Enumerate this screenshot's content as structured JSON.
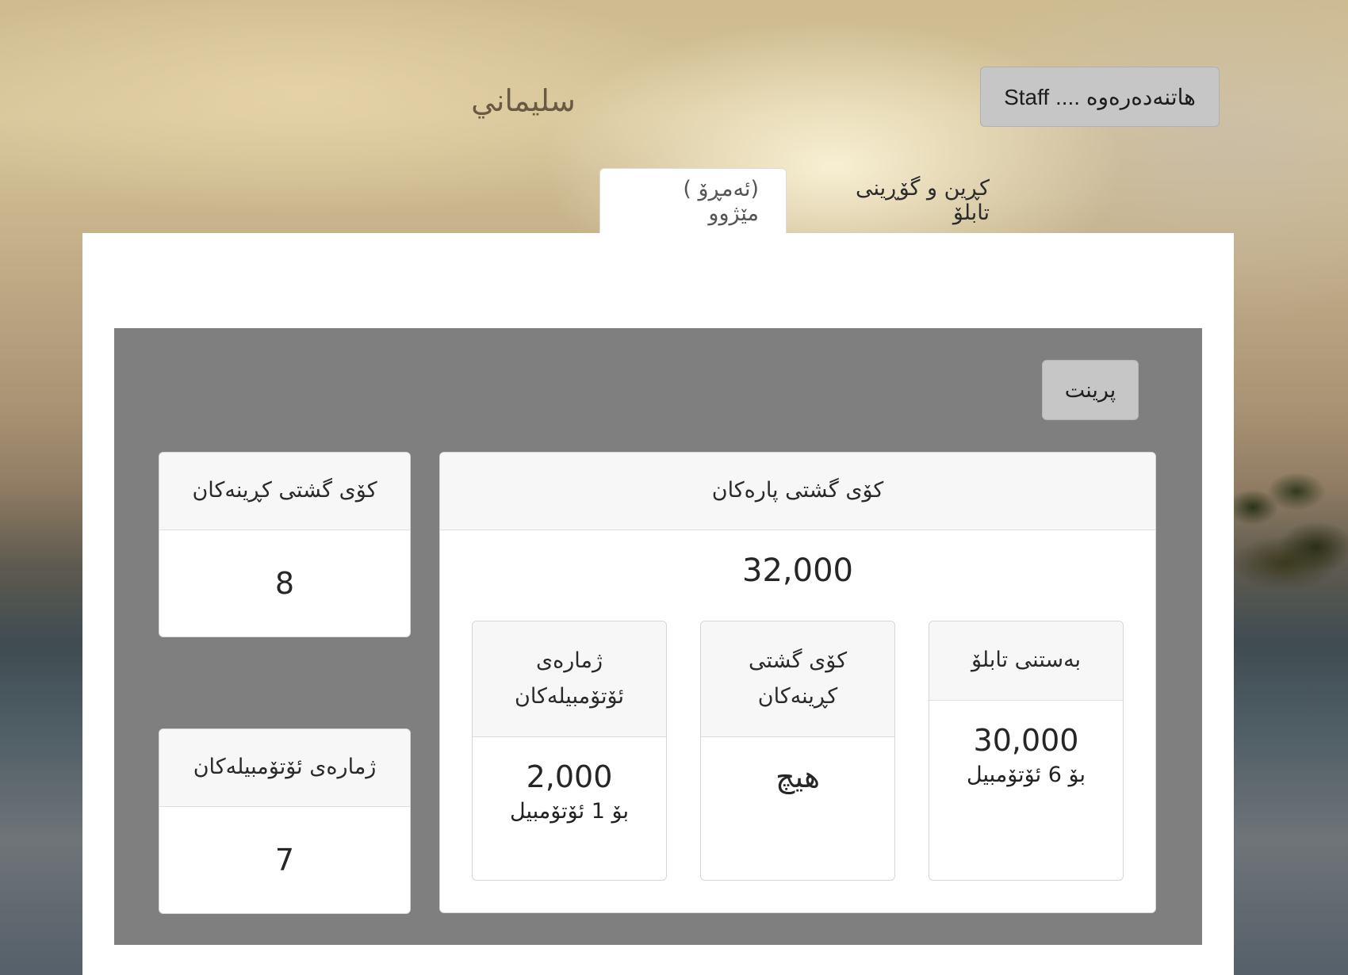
{
  "header": {
    "title": "سليماني",
    "staff_button": "هاتنەدەرەوە .... Staff"
  },
  "tabs": [
    {
      "label": "(ئەمڕۆ ) مێژوو",
      "active": true
    },
    {
      "label": "کڕین و گۆڕینی تابلۆ",
      "active": false
    }
  ],
  "report": {
    "print_button": "پرینت",
    "total_money": {
      "title": "کۆی گشتی پارەکان",
      "value": "32,000",
      "breakdown": [
        {
          "title": "بەستنی تابلۆ",
          "value": "30,000",
          "note": "بۆ 6 ئۆتۆمبیل"
        },
        {
          "title": "کۆی گشتی کڕینەکان",
          "value": "هیچ",
          "note": ""
        },
        {
          "title": "ژمارەی ئۆتۆمبیلەکان",
          "value": "2,000",
          "note": "بۆ 1 ئۆتۆمبیل"
        }
      ]
    },
    "total_purchases": {
      "title": "کۆی گشتی کڕینەکان",
      "value": "8"
    },
    "car_count": {
      "title": "ژمارەی ئۆتۆمبیلەکان",
      "value": "7"
    }
  },
  "colors": {
    "report_background": "#7f7f7f",
    "panel_background": "#ffffff",
    "button_gray": "#c6c6c6",
    "card_header": "#f7f7f7"
  }
}
